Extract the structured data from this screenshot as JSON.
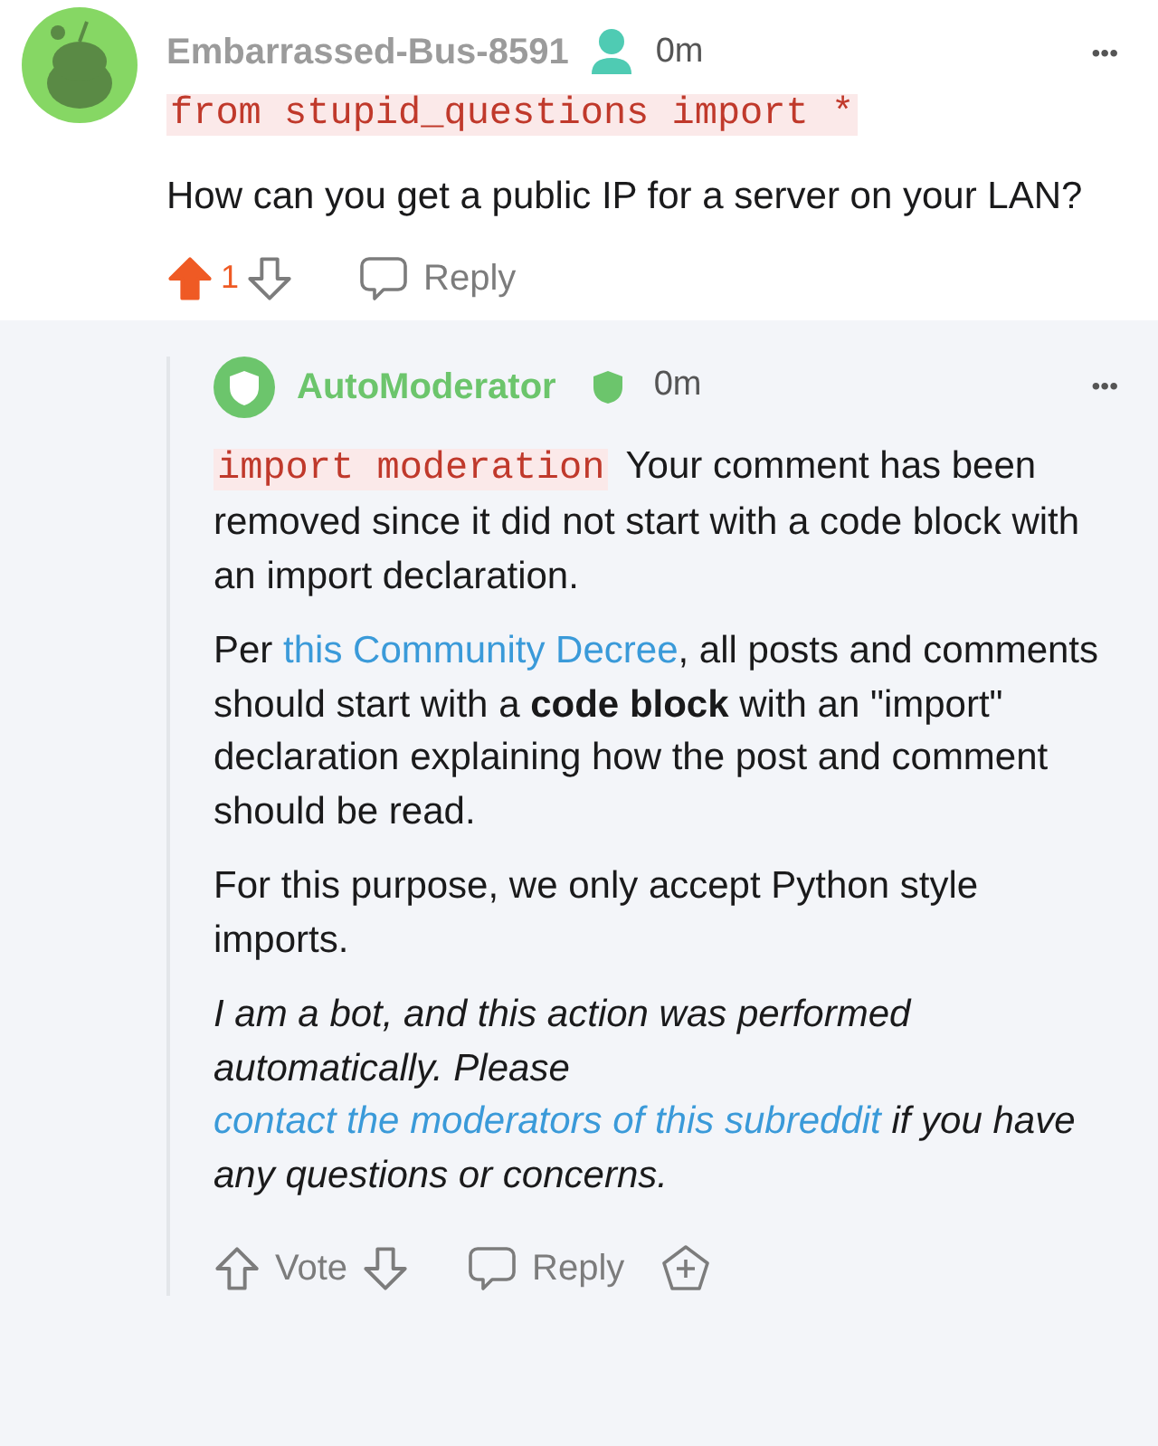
{
  "comment": {
    "username": "Embarrassed-Bus-8591",
    "time": "0m",
    "more": "•••",
    "code": "from stupid_questions import *",
    "body": "How can you get a public IP for a server on your LAN?",
    "upvoted": true,
    "score": "1",
    "reply": "Reply"
  },
  "reply": {
    "username": "AutoModerator",
    "time": "0m",
    "more": "•••",
    "paragraphs": [
      {
        "italic": false,
        "parts": [
          {
            "kind": "code",
            "text": "import moderation"
          },
          {
            "kind": "text",
            "text": " Your comment has been removed since it did not start with a code block with an import declaration."
          }
        ]
      },
      {
        "italic": false,
        "parts": [
          {
            "kind": "text",
            "text": "Per "
          },
          {
            "kind": "link",
            "text": "this Community Decree"
          },
          {
            "kind": "text",
            "text": ", all posts and comments should start with a **code block** with an \"import\" declaration explaining how the post and comment should be read."
          }
        ]
      },
      {
        "italic": false,
        "parts": [
          {
            "kind": "text",
            "text": "For this purpose, we only accept Python style imports."
          }
        ]
      },
      {
        "italic": true,
        "parts": [
          {
            "kind": "text",
            "text": "I am a bot, and this action was performed automatically. Please "
          },
          {
            "kind": "link",
            "text": "contact the moderators of this subreddit"
          },
          {
            "kind": "text",
            "text": " if you have any questions or concerns."
          }
        ]
      }
    ],
    "upvoted": false,
    "vote": "Vote",
    "reply": "Reply"
  }
}
